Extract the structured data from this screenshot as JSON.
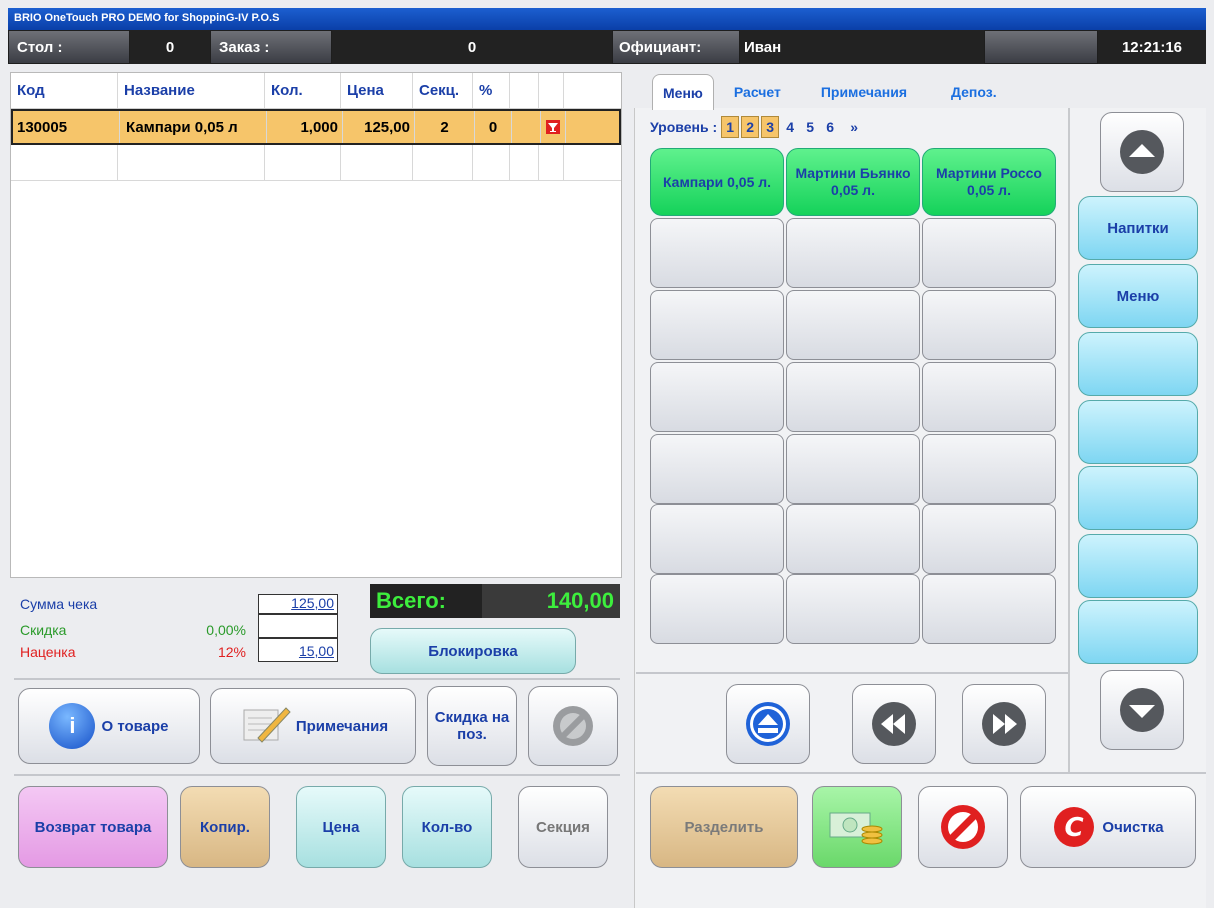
{
  "title": "BRIO OneTouch PRO DEMO for ShoppinG-IV P.O.S",
  "header": {
    "table_label": "Стол :",
    "table_value": "0",
    "order_label": "Заказ :",
    "order_value": "0",
    "waiter_label": "Официант:",
    "waiter_value": "Иван",
    "time": "12:21:16"
  },
  "grid": {
    "columns": [
      "Код",
      "Название",
      "Кол.",
      "Цена",
      "Секц.",
      "%",
      "",
      ""
    ],
    "rows": [
      {
        "code": "130005",
        "name": "Кампари 0,05 л",
        "qty": "1,000",
        "price": "125,00",
        "section": "2",
        "pct": "0"
      }
    ]
  },
  "summary": {
    "sum_label": "Сумма чека",
    "sum_value": "125,00",
    "discount_label": "Скидка",
    "discount_pct": "0,00%",
    "discount_value": "",
    "markup_label": "Наценка",
    "markup_pct": "12%",
    "markup_value": "15,00",
    "total_label": "Всего:",
    "total_value": "140,00"
  },
  "buttons": {
    "block": "Блокировка",
    "product_info": "О товаре",
    "notes": "Примечания",
    "item_discount": "Скидка на поз.",
    "return": "Возврат товара",
    "copy": "Копир.",
    "price": "Цена",
    "qty": "Кол-во",
    "section": "Секция",
    "split": "Разделить",
    "clear": "Очистка"
  },
  "tabs": [
    "Меню",
    "Расчет",
    "Примечания",
    "Депоз."
  ],
  "levels": {
    "label": "Уровень :",
    "items": [
      "1",
      "2",
      "3",
      "4",
      "5",
      "6",
      "»"
    ],
    "active": [
      "1",
      "2",
      "3"
    ]
  },
  "menu_items": [
    "Кампари 0,05 л.",
    "Мартини Бьянко 0,05 л.",
    "Мартини Россо 0,05 л."
  ],
  "categories": [
    "Напитки",
    "Меню",
    "",
    "",
    "",
    "",
    ""
  ],
  "colors": {
    "selected_row": "#f6c56a",
    "total_text": "#3dee3d",
    "link": "#1b3fa8",
    "menu_green": "#15d25a"
  }
}
